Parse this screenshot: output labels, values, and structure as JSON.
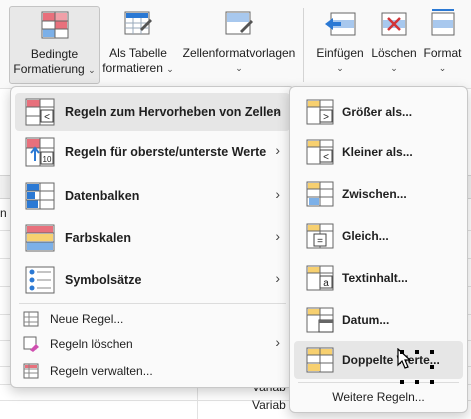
{
  "ribbon": {
    "conditional_formatting": {
      "line1": "Bedingte",
      "line2": "Formatierung",
      "chev": "⌄"
    },
    "format_as_table": {
      "line1": "Als Tabelle",
      "line2": "formatieren",
      "chev": "⌄"
    },
    "cell_styles": {
      "line1": "Zellenformatvorlagen",
      "chev": "⌄"
    },
    "insert": {
      "line1": "Einfügen",
      "chev": "⌄"
    },
    "delete": {
      "line1": "Löschen",
      "chev": "⌄"
    },
    "format": {
      "line1": "Format",
      "chev": "⌄"
    }
  },
  "sheet": {
    "cell_a": "n",
    "cell_b": "Variab",
    "cell_c": "Variab"
  },
  "main_menu": {
    "highlight_rules": "Regeln zum Hervorheben von Zellen",
    "top_bottom_rules": "Regeln für oberste/unterste Werte",
    "data_bars": "Datenbalken",
    "color_scales": "Farbskalen",
    "icon_sets": "Symbolsätze",
    "new_rule": "Neue Regel...",
    "clear_rules": "Regeln löschen",
    "manage_rules": "Regeln verwalten...",
    "arrow": "›"
  },
  "sub_menu": {
    "greater_than": "Größer als...",
    "less_than": "Kleiner als...",
    "between": "Zwischen...",
    "equal_to": "Gleich...",
    "text_contains": "Textinhalt...",
    "date_occurring": "Datum...",
    "duplicate_values": "Doppelte Werte...",
    "more_rules": "Weitere Regeln..."
  },
  "icons": {
    "top10_label": "10",
    "greater_symbol": ">",
    "less_symbol": "<",
    "equal_symbol": "=",
    "text_symbol": "a"
  },
  "colors": {
    "accent_blue": "#2b79d4",
    "highlight_red": "#e8707c",
    "highlight_yellow": "#f7d070",
    "menu_bg": "#fafafa",
    "hover_bg": "#e6e6e6"
  }
}
